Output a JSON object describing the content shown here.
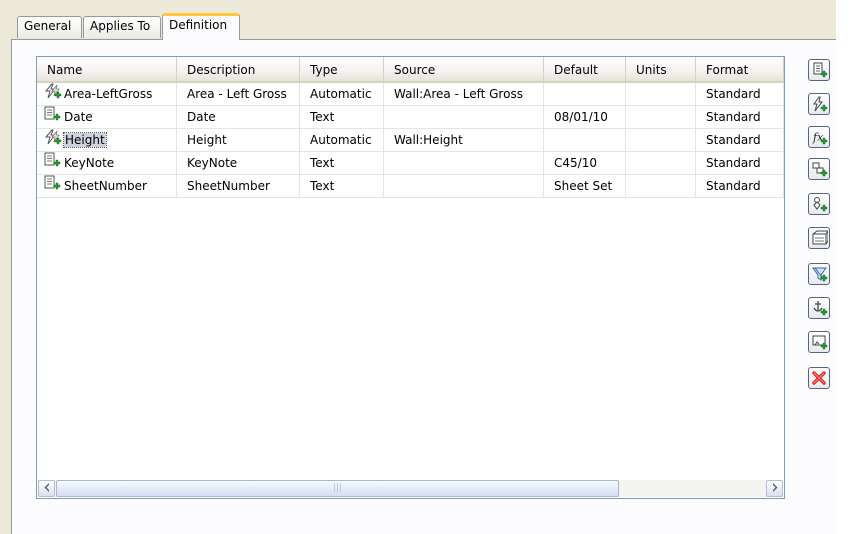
{
  "tabs": [
    {
      "label": "General"
    },
    {
      "label": "Applies To"
    },
    {
      "label": "Definition"
    }
  ],
  "table": {
    "columns": [
      "Name",
      "Description",
      "Type",
      "Source",
      "Default",
      "Units",
      "Format"
    ],
    "rows": [
      {
        "icon": "automatic-property-icon",
        "name": "Area-LeftGross",
        "description": "Area - Left Gross",
        "type": "Automatic",
        "source": "Wall:Area - Left Gross",
        "default": "",
        "units": "",
        "format": "Standard"
      },
      {
        "icon": "manual-property-icon",
        "name": "Date",
        "description": "Date",
        "type": "Text",
        "source": "",
        "default": "08/01/10",
        "units": "",
        "format": "Standard"
      },
      {
        "icon": "automatic-property-icon",
        "name": "Height",
        "description": "Height",
        "type": "Automatic",
        "source": "Wall:Height",
        "default": "",
        "units": "",
        "format": "Standard",
        "selected": true
      },
      {
        "icon": "manual-property-icon",
        "name": "KeyNote",
        "description": "KeyNote",
        "type": "Text",
        "source": "",
        "default": "C45/10",
        "units": "",
        "format": "Standard"
      },
      {
        "icon": "manual-property-icon",
        "name": "SheetNumber",
        "description": "SheetNumber",
        "type": "Text",
        "source": "",
        "default": "Sheet Set",
        "units": "",
        "format": "Standard"
      }
    ]
  },
  "side_buttons": [
    "add-manual-property-icon",
    "add-automatic-property-icon",
    "add-formula-property-icon",
    "add-anchor-property-icon",
    "add-location-property-icon",
    "add-classification-property-icon",
    "add-material-property-icon",
    "add-project-property-icon",
    "add-graphic-property-icon",
    "delete-property-icon"
  ],
  "colors": {
    "active_tab_accent": "#ffc83c",
    "selection": "#ccd2de",
    "add_plus_green": "#1f9d2a",
    "delete_red": "#e0261b"
  }
}
